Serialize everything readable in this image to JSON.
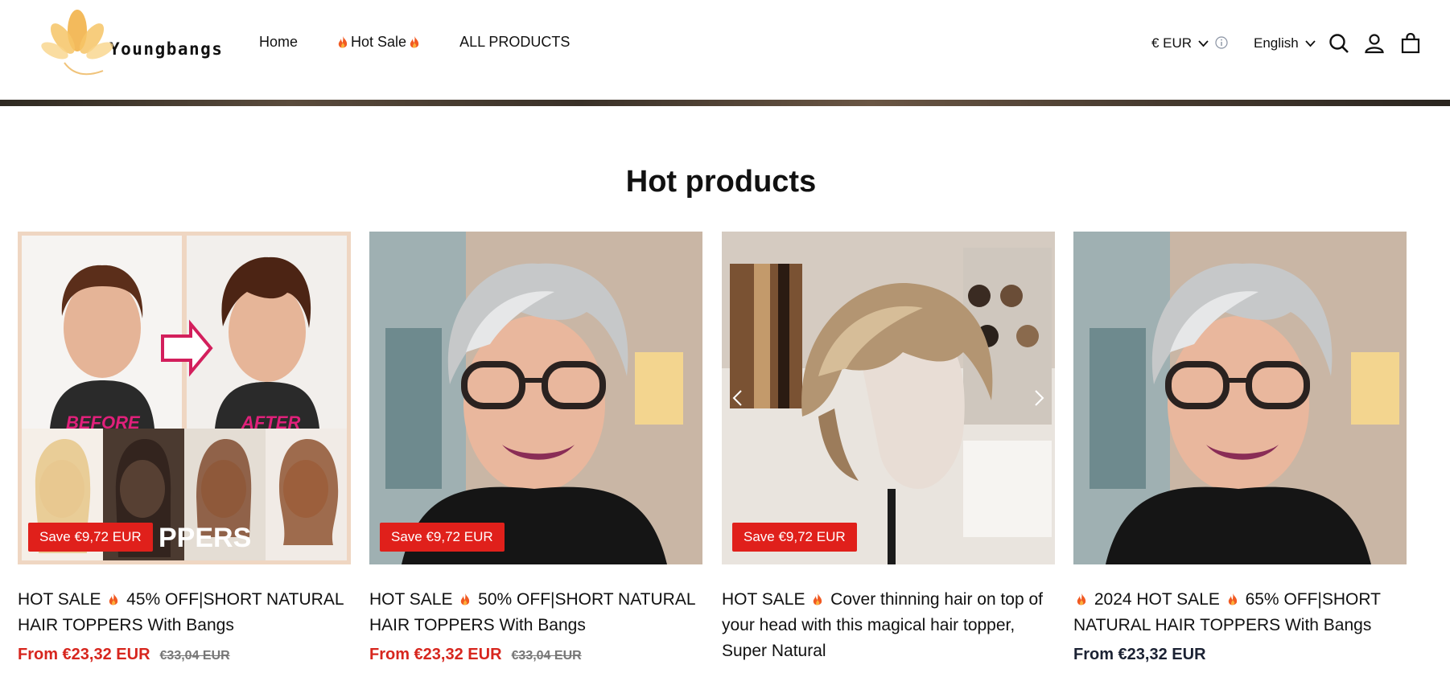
{
  "header": {
    "brand": "Youngbangs",
    "nav": {
      "home": "Home",
      "hot_sale": "Hot Sale",
      "all_products": "ALL PRODUCTS"
    },
    "currency": "€ EUR",
    "language": "English"
  },
  "section": {
    "title": "Hot products"
  },
  "products": [
    {
      "badge": "Save €9,72 EUR",
      "title_prefix": "HOT SALE",
      "title_rest": "45% OFF|SHORT NATURAL HAIR TOPPERS With Bangs",
      "price": "From €23,32 EUR",
      "compare": "€33,04 EUR",
      "image_overlay": {
        "before": "BEFORE",
        "after": "AFTER",
        "word": "PPERS"
      }
    },
    {
      "badge": "Save €9,72 EUR",
      "title_prefix": "HOT SALE",
      "title_rest": "50% OFF|SHORT NATURAL HAIR TOPPERS With Bangs",
      "price": "From €23,32 EUR",
      "compare": "€33,04 EUR"
    },
    {
      "badge": "Save €9,72 EUR",
      "title_prefix": "HOT SALE",
      "title_rest": "Cover thinning hair on top of your head with this magical hair topper, Super Natural"
    },
    {
      "title_prefix": "2024 HOT SALE",
      "title_rest": "65% OFF|SHORT NATURAL HAIR TOPPERS With Bangs",
      "price": "From €23,32 EUR"
    }
  ],
  "colors": {
    "sale_red": "#e0201b",
    "price_red": "#d7261e",
    "price_dark": "#1b2233"
  }
}
